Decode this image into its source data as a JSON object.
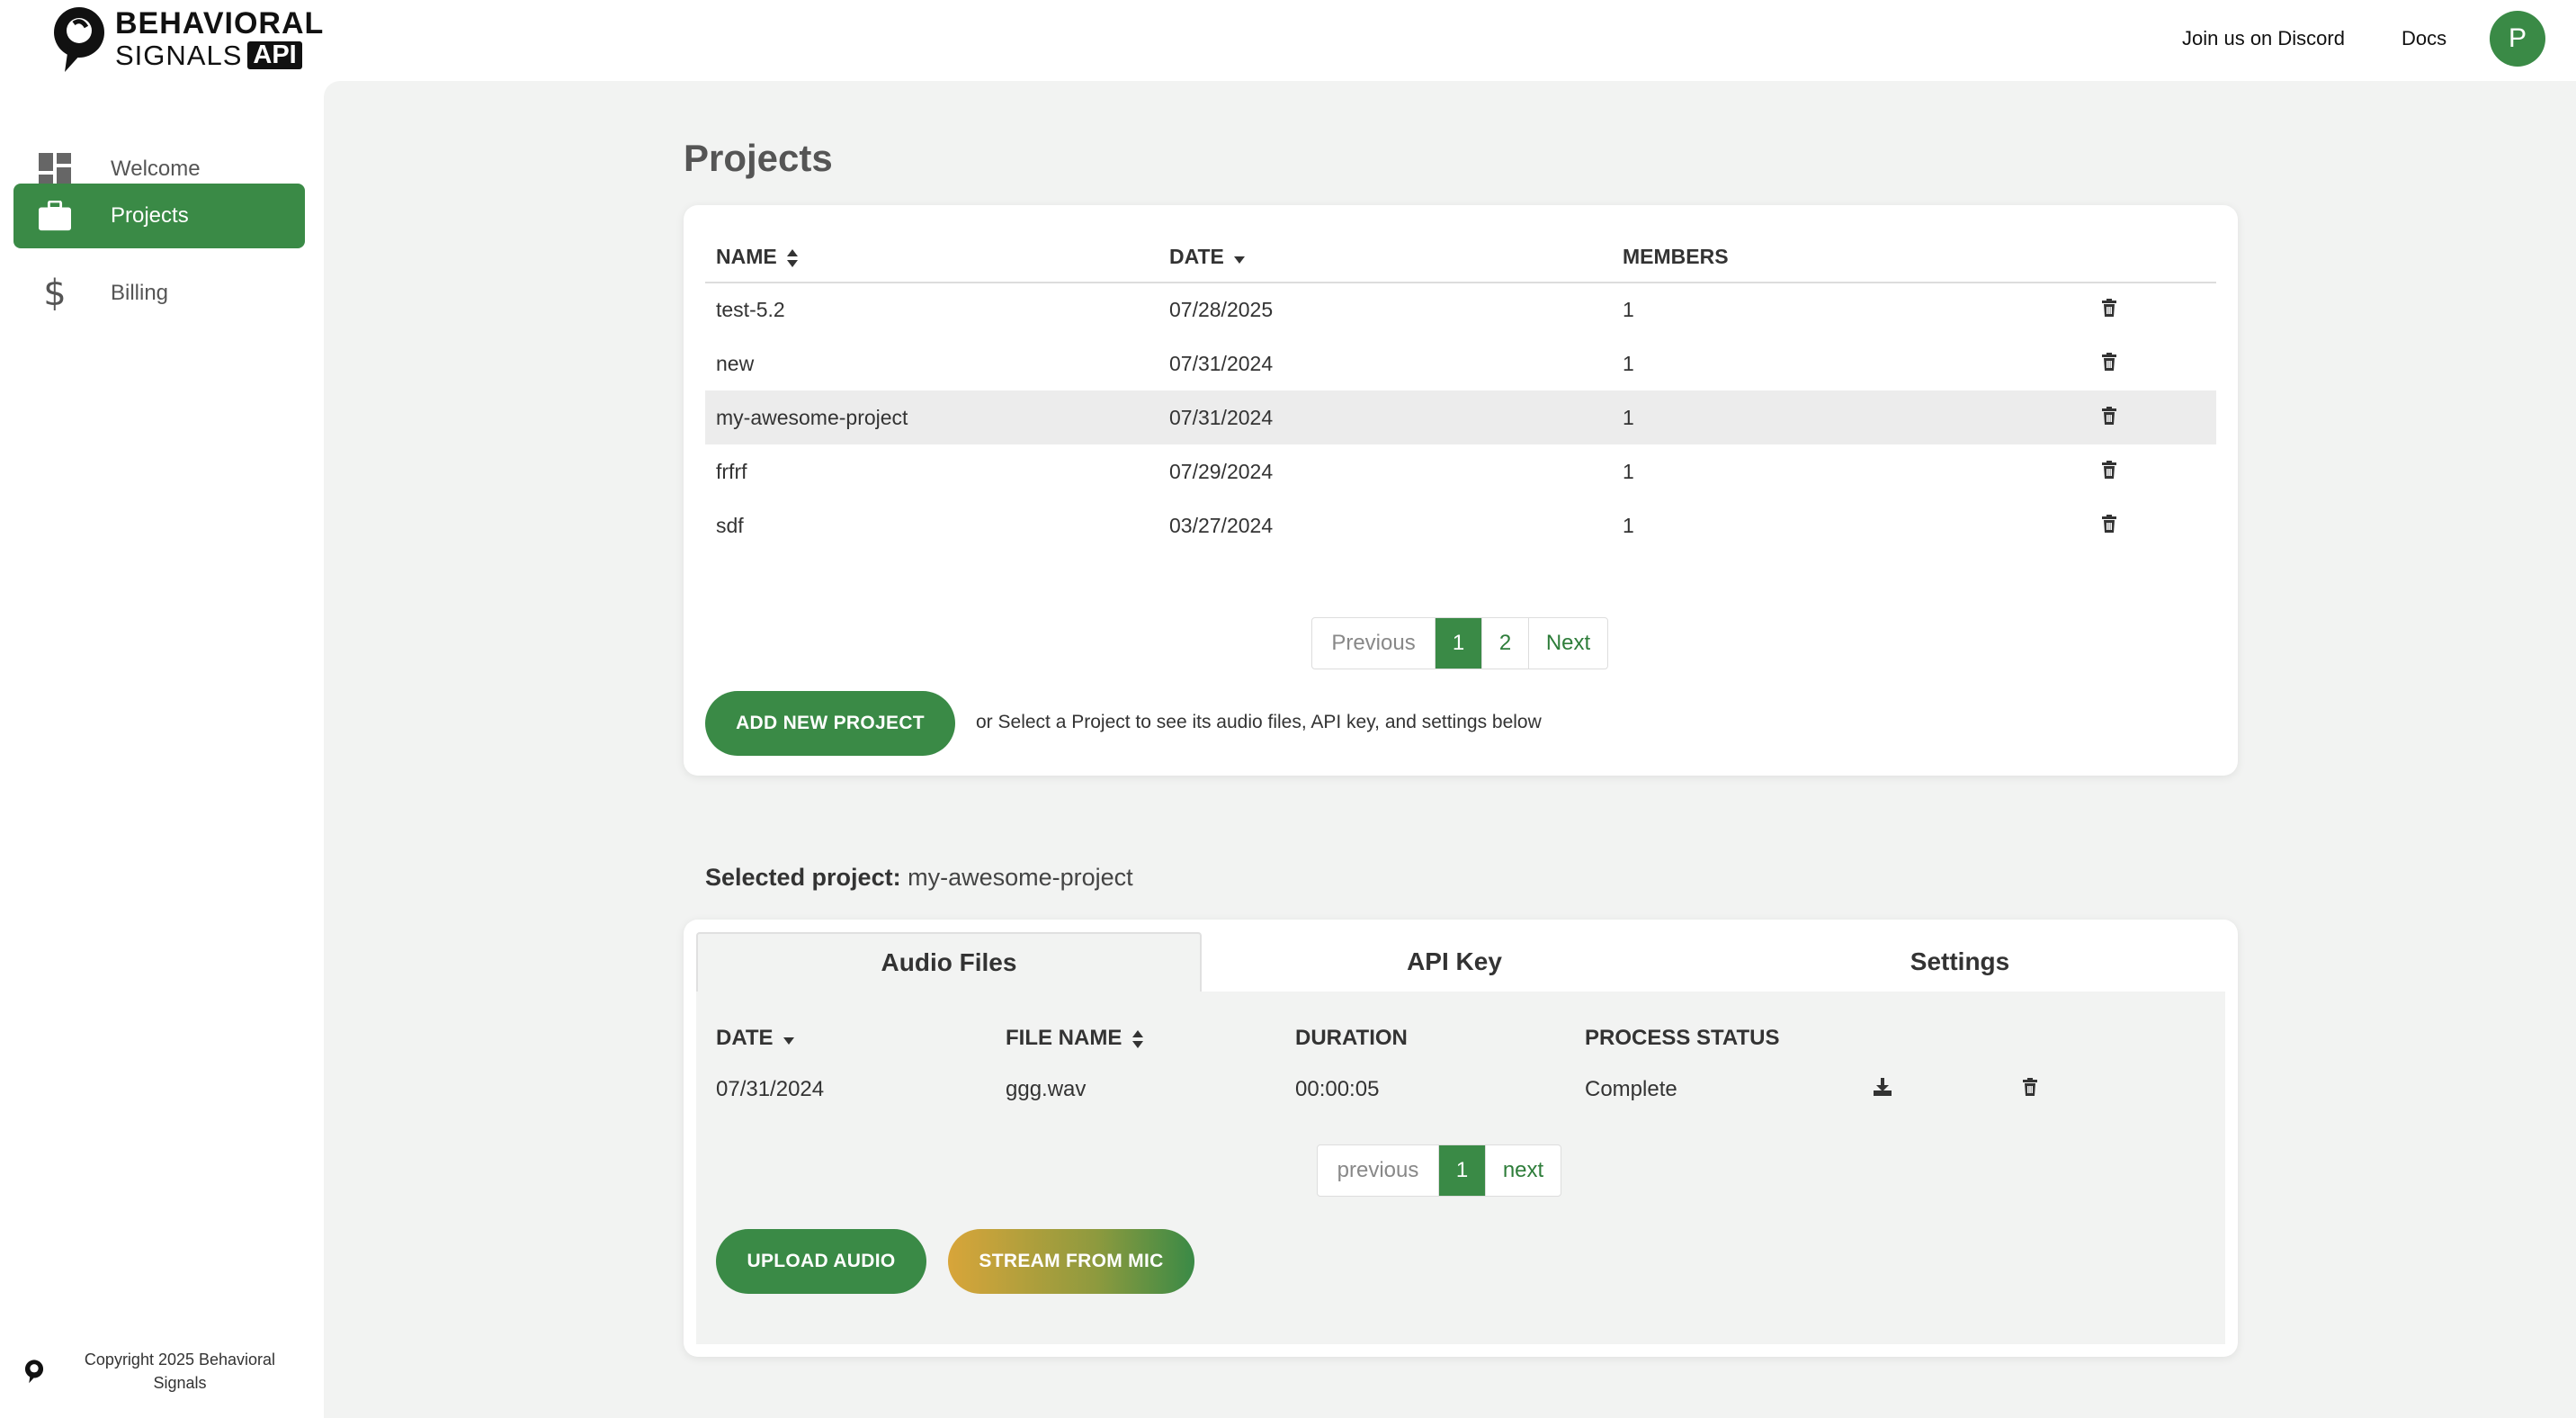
{
  "header": {
    "logo": {
      "line1": "BEHAVIORAL",
      "line2": "SIGNALS",
      "badge": "API"
    },
    "links": {
      "discord": "Join us on Discord",
      "docs": "Docs"
    },
    "avatar_initial": "P"
  },
  "sidebar": {
    "items": [
      {
        "label": "Welcome",
        "icon": "dashboard-icon",
        "active": false
      },
      {
        "label": "Projects",
        "icon": "briefcase-icon",
        "active": true
      },
      {
        "label": "Billing",
        "icon": "dollar-icon",
        "active": false
      }
    ],
    "copyright": "Copyright 2025 Behavioral Signals"
  },
  "projects": {
    "title": "Projects",
    "columns": {
      "name": "NAME",
      "date": "DATE",
      "members": "MEMBERS"
    },
    "rows": [
      {
        "name": "test-5.2",
        "date": "07/28/2025",
        "members": "1"
      },
      {
        "name": "new",
        "date": "07/31/2024",
        "members": "1"
      },
      {
        "name": "my-awesome-project",
        "date": "07/31/2024",
        "members": "1"
      },
      {
        "name": "frfrf",
        "date": "07/29/2024",
        "members": "1"
      },
      {
        "name": "sdf",
        "date": "03/27/2024",
        "members": "1"
      }
    ],
    "selected_row": "my-awesome-project",
    "pagination": {
      "previous": "Previous",
      "pages": [
        "1",
        "2"
      ],
      "current": "1",
      "next": "Next"
    },
    "add_button": "ADD NEW PROJECT",
    "hint": "or Select a Project to see its audio files, API key, and settings below"
  },
  "selected_project": {
    "label": "Selected project:",
    "name": "my-awesome-project"
  },
  "detail_tabs": {
    "tabs": [
      "Audio Files",
      "API Key",
      "Settings"
    ],
    "active": "Audio Files"
  },
  "audio_files": {
    "columns": {
      "date": "DATE",
      "file_name": "FILE NAME",
      "duration": "DURATION",
      "status": "PROCESS STATUS"
    },
    "rows": [
      {
        "date": "07/31/2024",
        "file_name": "ggg.wav",
        "duration": "00:00:05",
        "status": "Complete"
      }
    ],
    "pagination": {
      "previous": "previous",
      "current": "1",
      "next": "next"
    },
    "upload_button": "UPLOAD AUDIO",
    "stream_button": "STREAM FROM MIC"
  },
  "colors": {
    "accent": "#3a8a46",
    "background": "#f2f3f2",
    "stream_gradient_start": "#d8a53a"
  }
}
